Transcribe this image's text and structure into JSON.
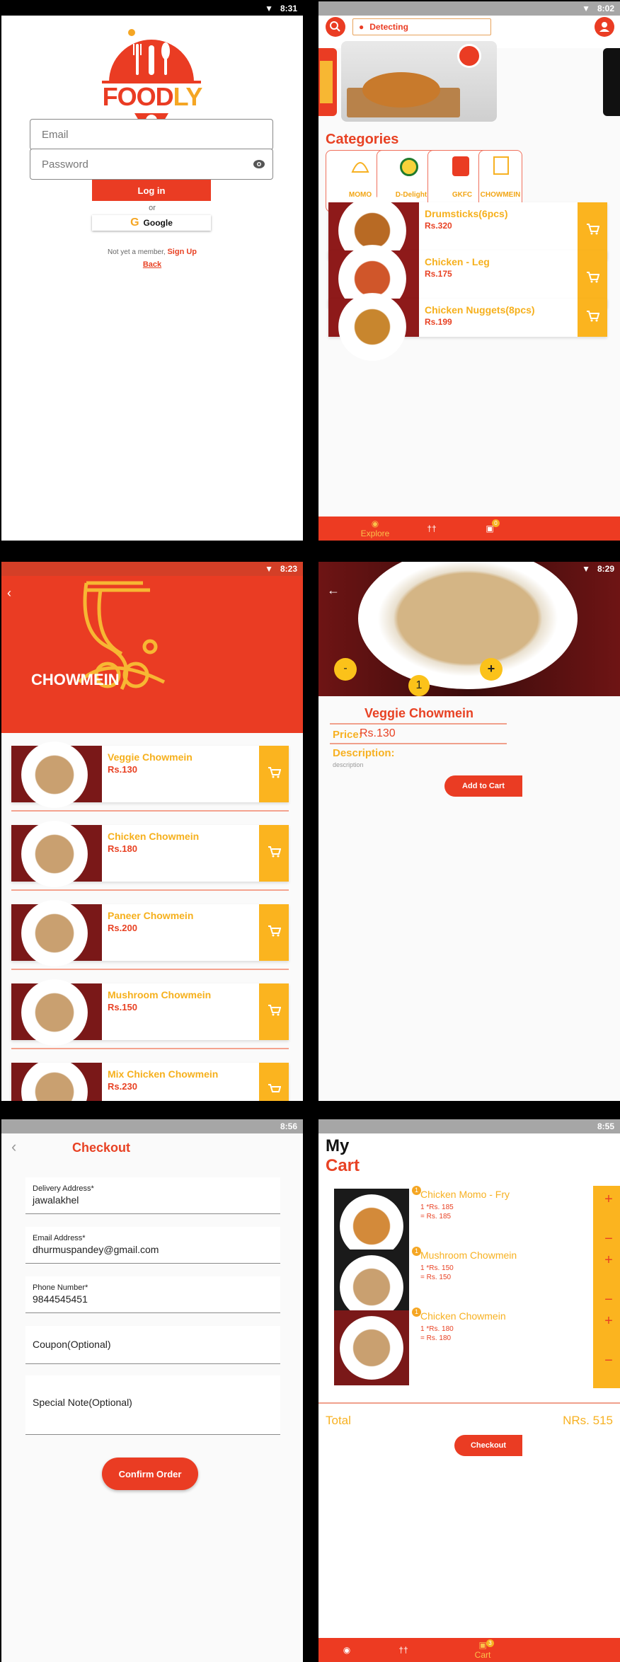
{
  "screens": {
    "login": {
      "time": "8:31",
      "logo_text": {
        "a": "FOOD",
        "b": "LY"
      },
      "email_placeholder": "Email",
      "password_placeholder": "Password",
      "login_label": "Log in",
      "or_label": "or",
      "google_label": "Google",
      "signup_prompt": "Not yet a member,",
      "signup_link": "Sign Up",
      "back_link": "Back"
    },
    "explore": {
      "time": "8:02",
      "location_text": "Detecting",
      "categories_title": "Categories",
      "categories": [
        "MOMO",
        "D-Delight",
        "GKFC",
        "CHOWMEIN"
      ],
      "items": [
        {
          "name": "Drumsticks(6pcs)",
          "price": "Rs.320"
        },
        {
          "name": "Chicken - Leg",
          "price": "Rs.175"
        },
        {
          "name": "Chicken Nuggets(8pcs)",
          "price": "Rs.199"
        }
      ],
      "nav_explore": "Explore",
      "cart_badge": "0"
    },
    "category": {
      "time": "8:23",
      "title": "CHOWMEIN",
      "items": [
        {
          "name": "Veggie Chowmein",
          "price": "Rs.130"
        },
        {
          "name": "Chicken Chowmein",
          "price": "Rs.180"
        },
        {
          "name": "Paneer Chowmein",
          "price": "Rs.200"
        },
        {
          "name": "Mushroom Chowmein",
          "price": "Rs.150"
        },
        {
          "name": "Mix Chicken Chowmein",
          "price": "Rs.230"
        }
      ]
    },
    "detail": {
      "time": "8:29",
      "minus": "-",
      "plus": "+",
      "quantity": "1",
      "name": "Veggie Chowmein",
      "price_label": "Price:",
      "price_value": "Rs.130",
      "desc_label": "Description:",
      "desc_value": "description",
      "add_to_cart": "Add to Cart"
    },
    "checkout": {
      "time": "8:56",
      "title": "Checkout",
      "address_label": "Delivery Address*",
      "address_value": "jawalakhel",
      "email_label": "Email Address*",
      "email_value": "dhurmuspandey@gmail.com",
      "phone_label": "Phone Number*",
      "phone_value": "9844545451",
      "coupon_placeholder": "Coupon(Optional)",
      "note_placeholder": "Special Note(Optional)",
      "confirm_label": "Confirm Order"
    },
    "cart": {
      "time": "8:55",
      "title_a": "My",
      "title_b": "Cart",
      "items": [
        {
          "name": "Chicken Momo - Fry",
          "qty_line": "1 *Rs. 185",
          "total_line": "= Rs. 185",
          "badge": "1"
        },
        {
          "name": "Mushroom Chowmein",
          "qty_line": "1 *Rs. 150",
          "total_line": "= Rs. 150",
          "badge": "1"
        },
        {
          "name": "Chicken Chowmein",
          "qty_line": "1 *Rs. 180",
          "total_line": "= Rs. 180",
          "badge": "1"
        }
      ],
      "plus": "+",
      "minus": "−",
      "total_label": "Total",
      "total_value": "NRs. 515",
      "checkout_label": "Checkout",
      "nav_cart": "Cart",
      "cart_badge": "3"
    }
  },
  "colors": {
    "primary_red": "#ea3c23",
    "accent_yellow": "#fbb41f"
  }
}
